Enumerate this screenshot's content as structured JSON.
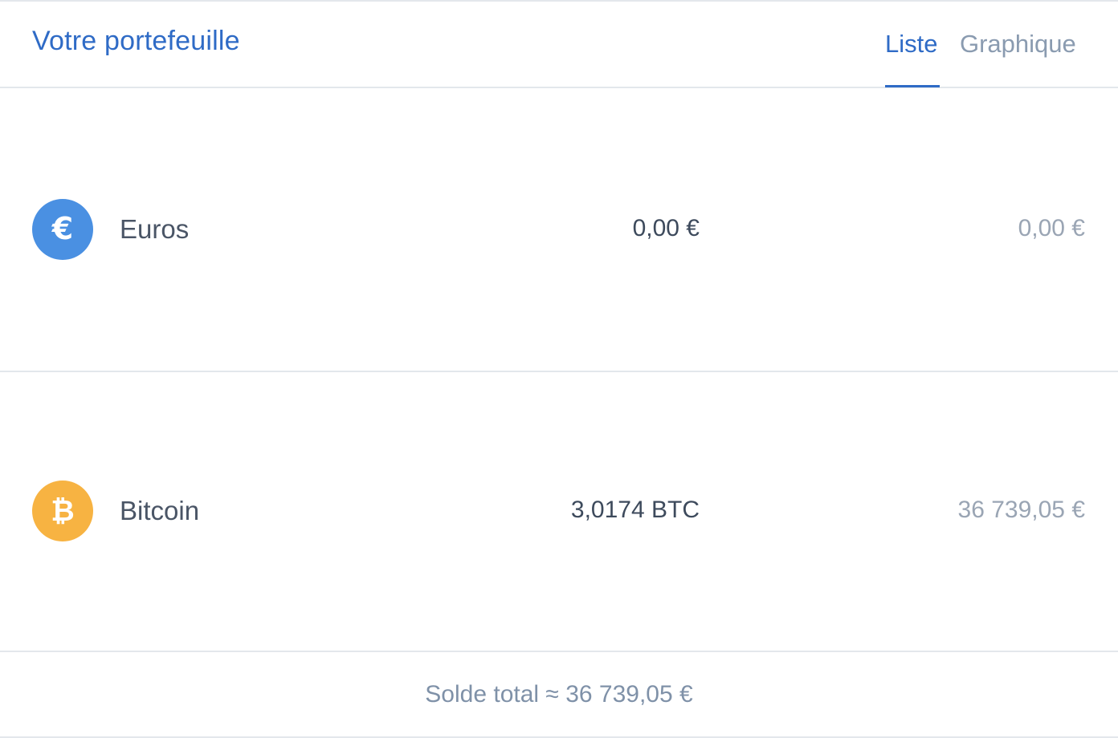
{
  "header": {
    "title": "Votre portefeuille",
    "tabs": [
      {
        "label": "Liste",
        "active": true
      },
      {
        "label": "Graphique",
        "active": false
      }
    ]
  },
  "accounts": [
    {
      "name": "Euros",
      "icon": "euro-icon",
      "icon_color": "#4a90e2",
      "icon_glyph": "€",
      "amount": "0,00 €",
      "fiat_value": "0,00 €"
    },
    {
      "name": "Bitcoin",
      "icon": "bitcoin-icon",
      "icon_color": "#f7b342",
      "icon_glyph": "₿",
      "amount": "3,0174 BTC",
      "fiat_value": "36 739,05 €"
    }
  ],
  "footer": {
    "total_label": "Solde total ≈ 36 739,05 €"
  },
  "colors": {
    "accent": "#2f6bc6",
    "muted": "#8a9bb0",
    "divider": "#e3e7ec"
  }
}
